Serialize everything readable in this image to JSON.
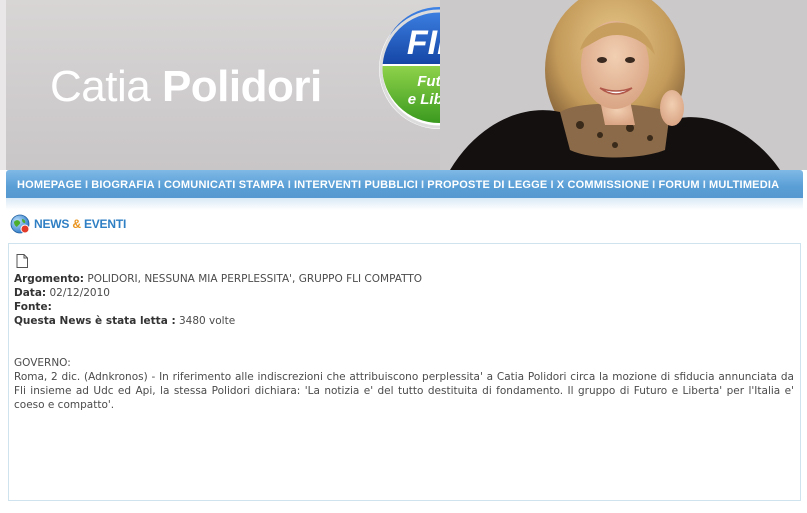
{
  "header": {
    "title_first": "Catia",
    "title_last": "Polidori",
    "logo": {
      "top_text": "FINI",
      "line1": "Futuro",
      "line2": "e Libertà"
    }
  },
  "nav": {
    "items": [
      {
        "label": "HOMEPAGE"
      },
      {
        "label": "BIOGRAFIA"
      },
      {
        "label": "COMUNICATI STAMPA"
      },
      {
        "label": "INTERVENTI PUBBLICI"
      },
      {
        "label": "PROPOSTE DI LEGGE"
      },
      {
        "label": "X COMMISSIONE"
      },
      {
        "label": "FORUM"
      },
      {
        "label": "MULTIMEDIA"
      }
    ],
    "separator": "I"
  },
  "section": {
    "heading_a": "NEWS",
    "heading_amp": "&",
    "heading_b": "EVENTI"
  },
  "news": {
    "argomento_label": "Argomento:",
    "argomento_value": "POLIDORI, NESSUNA MIA PERPLESSITA', GRUPPO FLI COMPATTO",
    "data_label": "Data:",
    "data_value": "02/12/2010",
    "fonte_label": "Fonte:",
    "fonte_value": "",
    "letta_label": "Questa News è stata letta :",
    "letta_value": "3480 volte",
    "body_heading": "GOVERNO:",
    "body_text": "Roma, 2 dic. (Adnkronos) - In riferimento alle indiscrezioni che attribuiscono perplessita' a Catia Polidori circa la mozione di sfiducia annunciata da Fli insieme ad Udc ed Api, la stessa Polidori dichiara: 'La notizia e' del tutto destituita di fondamento. Il gruppo di Futuro e Liberta' per l'Italia e' coeso e compatto'."
  },
  "colors": {
    "nav": "#5a9fd6",
    "heading": "#2f7fc4",
    "accent_orange": "#e8931e",
    "logo_blue": "#1e56b8",
    "logo_green": "#4cae2a"
  }
}
